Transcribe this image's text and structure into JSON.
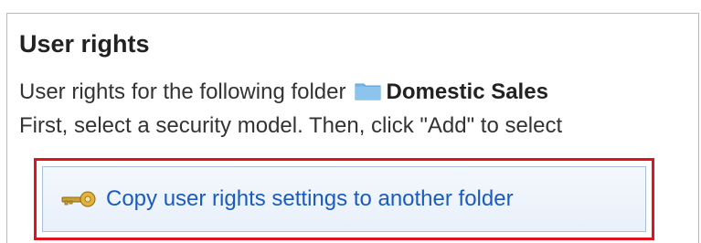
{
  "header": {
    "title": "User rights"
  },
  "description": {
    "line1_text": "User rights for the following folder",
    "folder_icon": "folder-icon",
    "folder_name": "Domestic Sales",
    "line2_text": "First, select a security model. Then, click \"Add\" to select"
  },
  "actions": {
    "copy_rights_label": "Copy user rights settings to another folder",
    "copy_rights_icon": "key-icon"
  },
  "colors": {
    "highlight_border": "#e0141e",
    "link_text": "#1a5bc2",
    "folder_icon": "#7ab8e8"
  }
}
